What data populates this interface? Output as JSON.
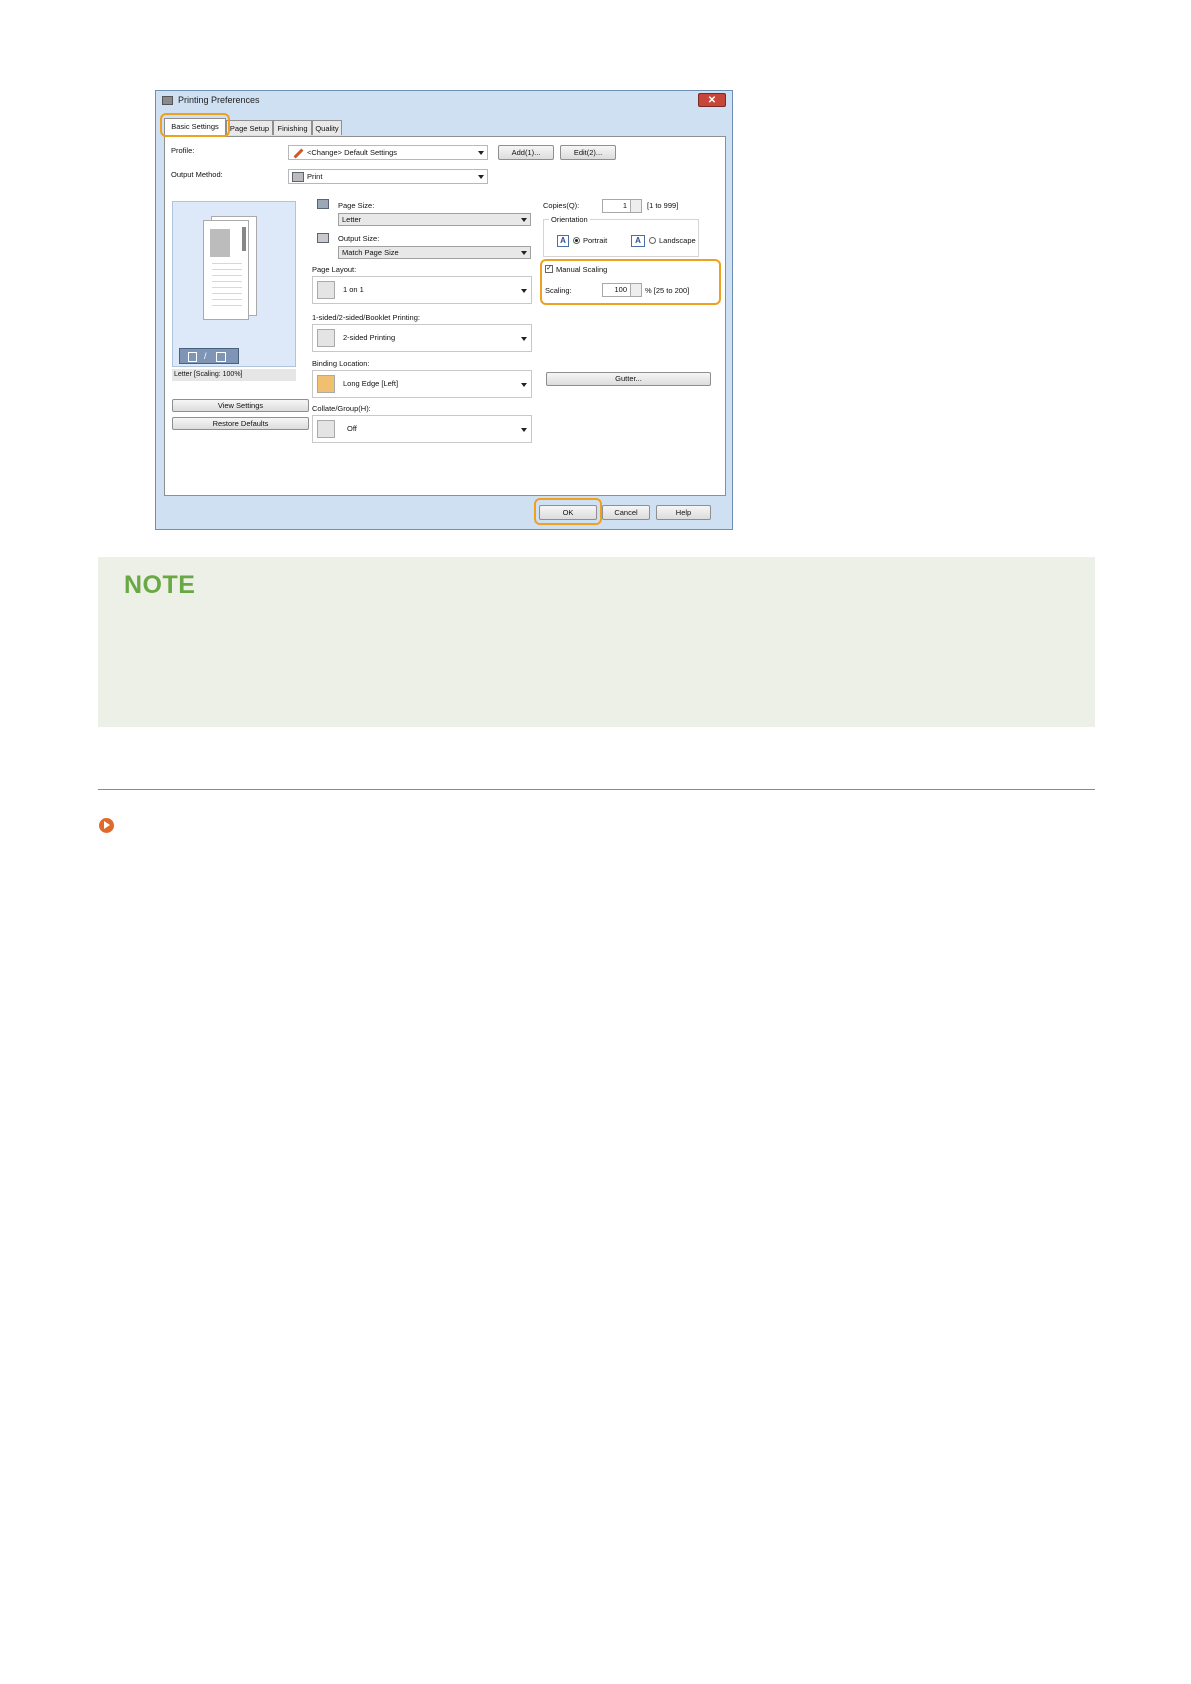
{
  "dialog": {
    "title": "Printing Preferences",
    "close_label": "✕",
    "tabs": [
      "Basic Settings",
      "Page Setup",
      "Finishing",
      "Quality"
    ],
    "profile_label": "Profile:",
    "profile_value": "<Change> Default Settings",
    "add_button": "Add(1)...",
    "edit_button": "Edit(2)...",
    "output_method_label": "Output Method:",
    "output_method_value": "Print",
    "preview_caption": "Letter [Scaling: 100%]",
    "view_settings_button": "View Settings",
    "restore_defaults_button": "Restore Defaults",
    "page_size_label": "Page Size:",
    "page_size_value": "Letter",
    "output_size_label": "Output Size:",
    "output_size_value": "Match Page Size",
    "page_layout_label": "Page Layout:",
    "page_layout_value": "1 on 1",
    "sided_label": "1-sided/2-sided/Booklet Printing:",
    "sided_value": "2-sided Printing",
    "binding_label": "Binding Location:",
    "binding_value": "Long Edge [Left]",
    "collate_label": "Collate/Group(H):",
    "collate_value": "Off",
    "copies_label": "Copies(Q):",
    "copies_value": "1",
    "copies_range": "[1 to 999]",
    "orientation_label": "Orientation",
    "portrait_label": "Portrait",
    "landscape_label": "Landscape",
    "orientation_selected": "Portrait",
    "manual_scaling_label": "Manual Scaling",
    "manual_scaling_checked": true,
    "scaling_label": "Scaling:",
    "scaling_value": "100",
    "scaling_range": "% [25 to 200]",
    "gutter_button": "Gutter...",
    "ok_button": "OK",
    "cancel_button": "Cancel",
    "help_button": "Help",
    "highlight_color": "#f0a020"
  },
  "note": {
    "title": "NOTE",
    "title_color": "#6aa843",
    "background": "#ecf0e7"
  },
  "link_icon_color": "#e06a2a"
}
